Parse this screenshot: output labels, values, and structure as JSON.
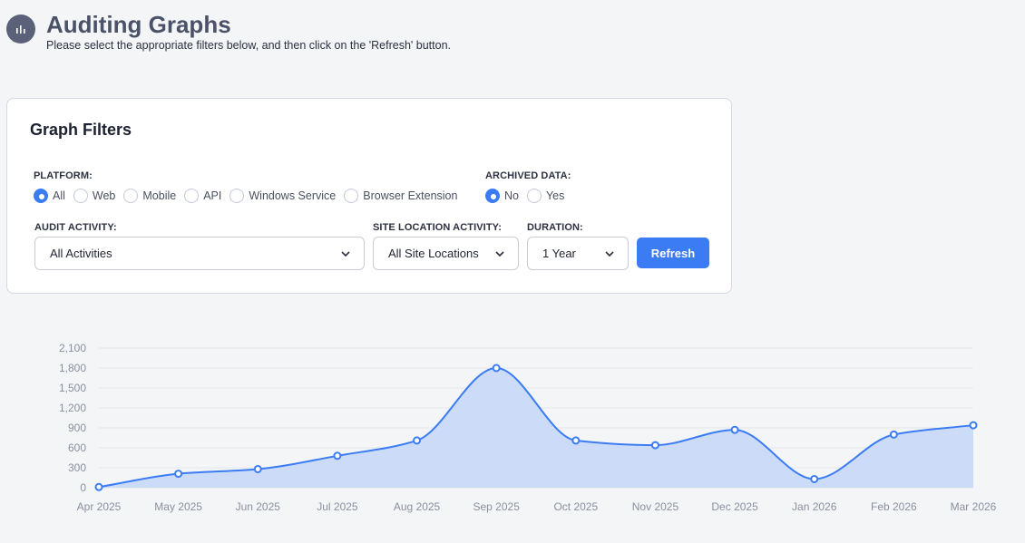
{
  "header": {
    "title": "Auditing Graphs",
    "subtitle": "Please select the appropriate filters below, and then click on the 'Refresh' button.",
    "icon": "bar-chart-icon"
  },
  "filters": {
    "title": "Graph Filters",
    "platform": {
      "label": "PLATFORM:",
      "options": [
        "All",
        "Web",
        "Mobile",
        "API",
        "Windows Service",
        "Browser Extension"
      ],
      "selected": "All"
    },
    "archived": {
      "label": "ARCHIVED DATA:",
      "options": [
        "No",
        "Yes"
      ],
      "selected": "No"
    },
    "audit_activity": {
      "label": "AUDIT ACTIVITY:",
      "value": "All Activities"
    },
    "site_location": {
      "label": "SITE LOCATION ACTIVITY:",
      "value": "All Site Locations"
    },
    "duration": {
      "label": "DURATION:",
      "value": "1 Year"
    },
    "refresh_label": "Refresh"
  },
  "colors": {
    "accent": "#3b7cf5",
    "area_fill": "#c9daf8",
    "grid": "#e4e6eb"
  },
  "chart_data": {
    "type": "area",
    "categories": [
      "Apr 2025",
      "May 2025",
      "Jun 2025",
      "Jul 2025",
      "Aug 2025",
      "Sep 2025",
      "Oct 2025",
      "Nov 2025",
      "Dec 2025",
      "Jan 2026",
      "Feb 2026",
      "Mar 2026"
    ],
    "series": [
      {
        "values": [
          10,
          210,
          280,
          480,
          710,
          1800,
          710,
          640,
          870,
          130,
          800,
          940
        ]
      }
    ],
    "yticks": [
      "0",
      "300",
      "600",
      "900",
      "1,200",
      "1,500",
      "1,800",
      "2,100"
    ],
    "ylim": [
      0,
      2100
    ],
    "grid": true,
    "legend": "none"
  }
}
